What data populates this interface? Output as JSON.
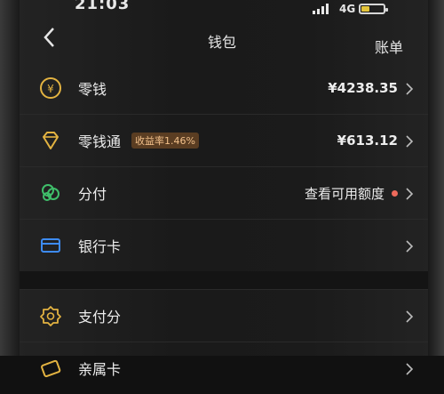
{
  "status": {
    "time": "21:03",
    "network": "4G",
    "battery_level": 0.35,
    "battery_color": "#e3c43a"
  },
  "nav": {
    "title": "钱包",
    "bill": "账单"
  },
  "wallet": {
    "change": {
      "label": "零钱",
      "value": "¥4238.35"
    },
    "lct": {
      "label": "零钱通",
      "badge": "收益率1.46%",
      "value": "¥613.12"
    },
    "fenfu": {
      "label": "分付",
      "hint": "查看可用额度"
    },
    "card": {
      "label": "银行卡"
    }
  },
  "credit": {
    "pay_score": {
      "label": "支付分"
    },
    "member": {
      "label": "亲属卡"
    }
  },
  "colors": {
    "accent": "#e3b341",
    "badge_text": "#f2c08a",
    "badge_bg": "#5a3d22",
    "dot": "#ee6a5b"
  },
  "icons": [
    "back-icon",
    "coin-icon",
    "diamond-icon",
    "clover-icon",
    "bank-card-icon",
    "badge-icon",
    "family-card-icon",
    "chevron-right-icon"
  ]
}
